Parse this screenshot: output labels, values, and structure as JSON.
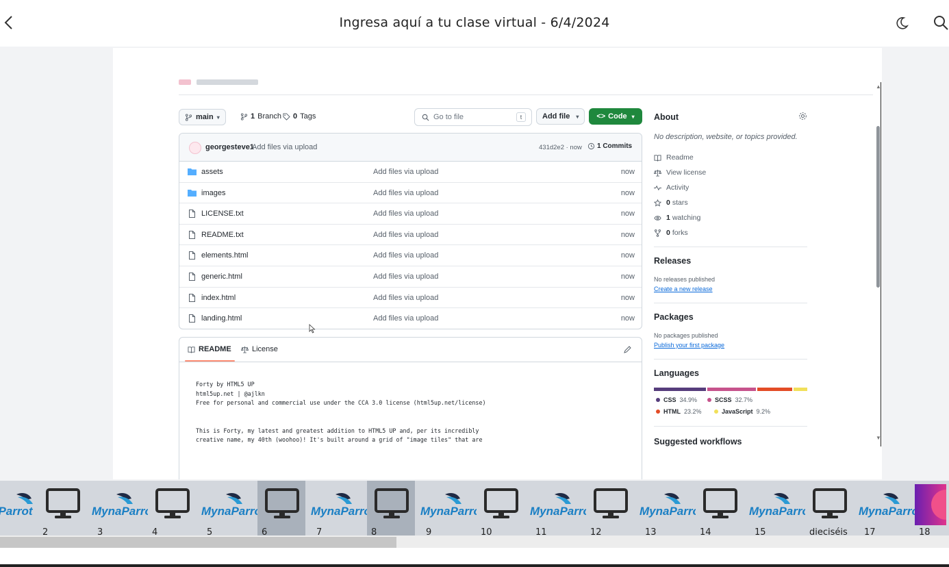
{
  "header": {
    "title": "Ingresa aquí a tu clase virtual - 6/4/2024"
  },
  "repo": {
    "branch": "main",
    "branches_count": "1",
    "branches_label": "Branch",
    "tags_count": "0",
    "tags_label": "Tags",
    "goto_placeholder": "Go to file",
    "goto_shortcut": "t",
    "add_file_label": "Add file",
    "code_label": "Code",
    "latest_commit": {
      "user": "georgesteve1",
      "message": "Add files via upload",
      "hash_time": "431d2e2 · now",
      "commits": "1 Commits"
    },
    "files": [
      {
        "name": "assets",
        "type": "folder",
        "message": "Add files via upload",
        "time": "now"
      },
      {
        "name": "images",
        "type": "folder",
        "message": "Add files via upload",
        "time": "now"
      },
      {
        "name": "LICENSE.txt",
        "type": "file",
        "message": "Add files via upload",
        "time": "now"
      },
      {
        "name": "README.txt",
        "type": "file",
        "message": "Add files via upload",
        "time": "now"
      },
      {
        "name": "elements.html",
        "type": "file",
        "message": "Add files via upload",
        "time": "now"
      },
      {
        "name": "generic.html",
        "type": "file",
        "message": "Add files via upload",
        "time": "now"
      },
      {
        "name": "index.html",
        "type": "file",
        "message": "Add files via upload",
        "time": "now"
      },
      {
        "name": "landing.html",
        "type": "file",
        "message": "Add files via upload",
        "time": "now"
      }
    ],
    "readme": {
      "tab_readme": "README",
      "tab_license": "License",
      "lines": [
        "Forty by HTML5 UP",
        "html5up.net | @ajlkn",
        "Free for personal and commercial use under the CCA 3.0 license (html5up.net/license)",
        "",
        "",
        "This is Forty, my latest and greatest addition to HTML5 UP and, per its incredibly",
        "creative name, my 40th (woohoo)! It's built around a grid of \"image tiles\" that are"
      ]
    }
  },
  "about": {
    "title": "About",
    "description": "No description, website, or topics provided.",
    "readme": "Readme",
    "license": "View license",
    "activity": "Activity",
    "stars_count": "0",
    "stars_label": "stars",
    "watching_count": "1",
    "watching_label": "watching",
    "forks_count": "0",
    "forks_label": "forks",
    "releases_title": "Releases",
    "releases_none": "No releases published",
    "releases_link": "Create a new release",
    "packages_title": "Packages",
    "packages_none": "No packages published",
    "packages_link": "Publish your first package",
    "languages_title": "Languages",
    "languages": [
      {
        "name": "CSS",
        "percent": "34.9%",
        "value": 34.9,
        "color": "#563d7c"
      },
      {
        "name": "SCSS",
        "percent": "32.7%",
        "value": 32.7,
        "color": "#c6538c"
      },
      {
        "name": "HTML",
        "percent": "23.2%",
        "value": 23.2,
        "color": "#e34c26"
      },
      {
        "name": "JavaScript",
        "percent": "9.2%",
        "value": 9.2,
        "color": "#f1e05a"
      }
    ],
    "workflows_title": "Suggested workflows"
  },
  "filmstrip": {
    "selected": [
      "6",
      "8"
    ],
    "items": [
      {
        "label": "",
        "kind": "logo"
      },
      {
        "label": "2",
        "kind": "monitor"
      },
      {
        "label": "3",
        "kind": "logo"
      },
      {
        "label": "4",
        "kind": "monitor"
      },
      {
        "label": "5",
        "kind": "logo"
      },
      {
        "label": "6",
        "kind": "monitor"
      },
      {
        "label": "7",
        "kind": "logo"
      },
      {
        "label": "8",
        "kind": "monitor"
      },
      {
        "label": "9",
        "kind": "logo"
      },
      {
        "label": "10",
        "kind": "monitor"
      },
      {
        "label": "11",
        "kind": "logo"
      },
      {
        "label": "12",
        "kind": "monitor"
      },
      {
        "label": "13",
        "kind": "logo"
      },
      {
        "label": "14",
        "kind": "monitor"
      },
      {
        "label": "15",
        "kind": "logo"
      },
      {
        "label": "dieciséis",
        "kind": "monitor"
      },
      {
        "label": "17",
        "kind": "logo"
      },
      {
        "label": "18",
        "kind": "gradient"
      }
    ],
    "logo_text": "MynaParrot",
    "logo_text_cut": "aParrot"
  },
  "colors": {
    "code_button": "#1f883d",
    "link": "#0969da",
    "strip_bg": "#d3d7dd",
    "strip_selected": "#a9b1bb"
  }
}
